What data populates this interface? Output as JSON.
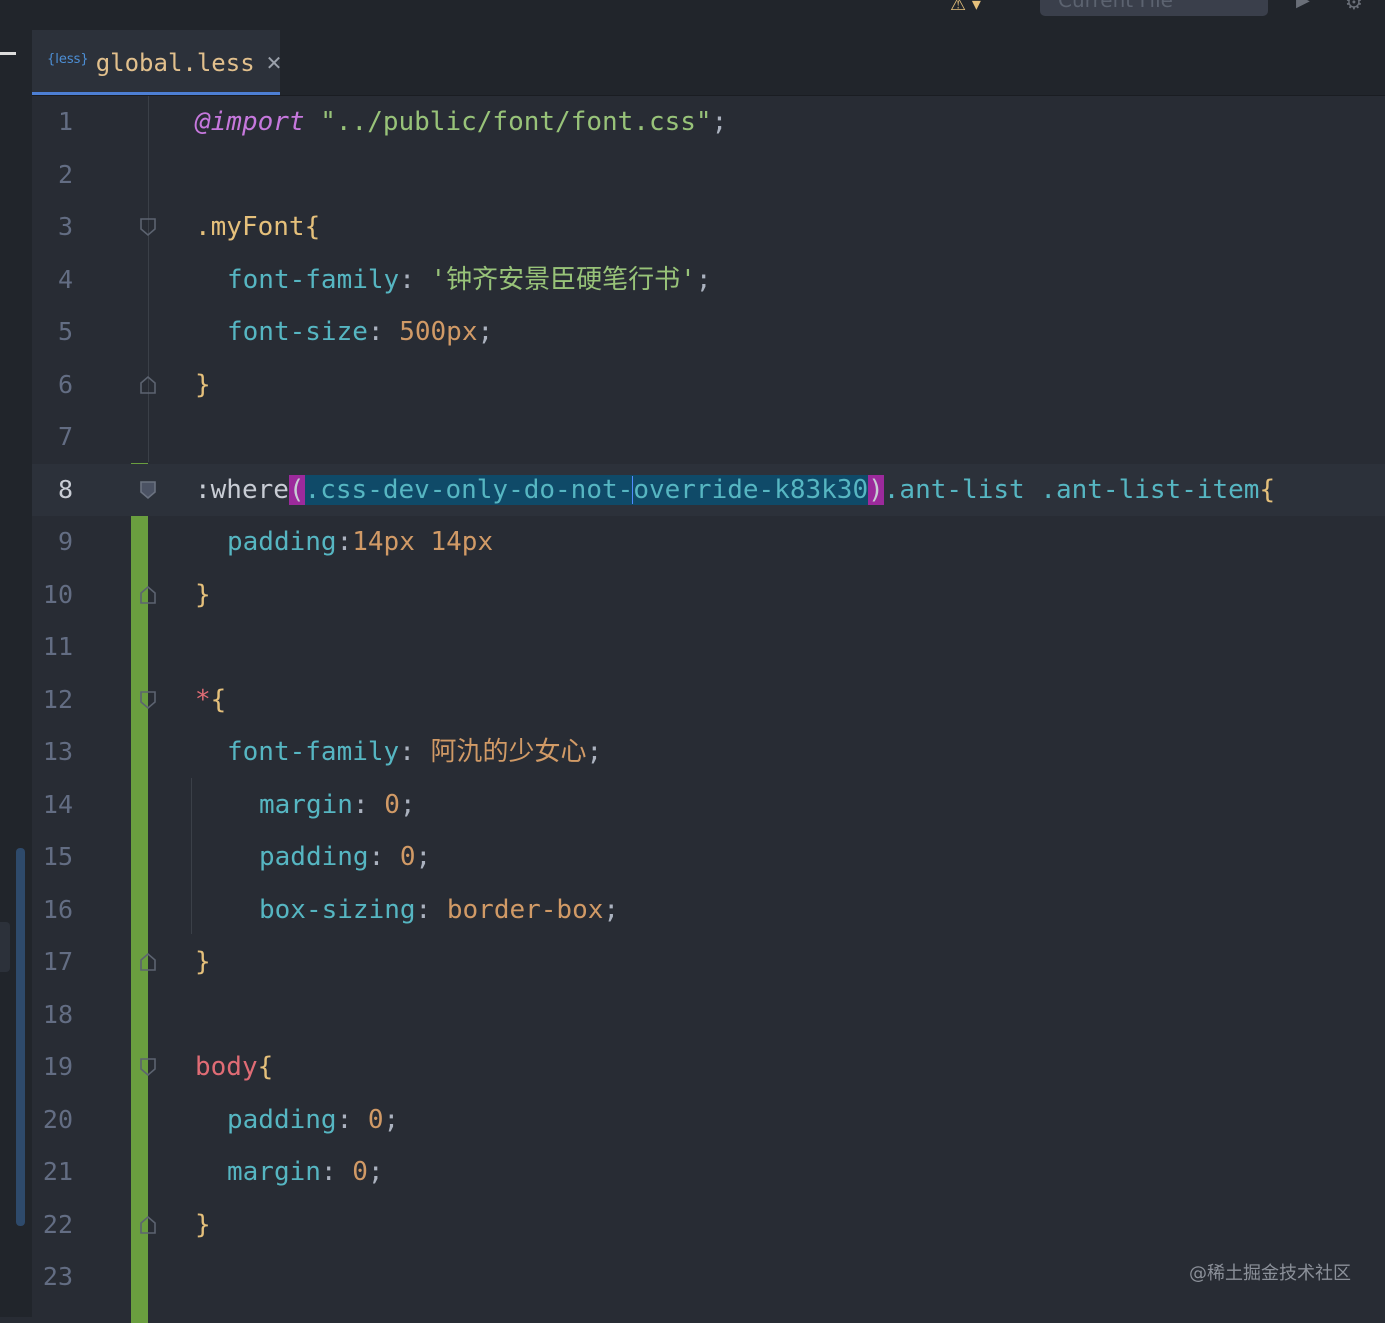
{
  "toolbar": {
    "config_label": "Current File",
    "warn_glyph": "⚠ ▾",
    "run_glyph": "▶",
    "gear_glyph": "⚙"
  },
  "tab": {
    "icon_text": "{less}",
    "label": "global.less",
    "close_glyph": "✕"
  },
  "gutter": {
    "line_numbers": [
      "1",
      "2",
      "3",
      "4",
      "5",
      "6",
      "7",
      "8",
      "9",
      "10",
      "11",
      "12",
      "13",
      "14",
      "15",
      "16",
      "17",
      "18",
      "19",
      "20",
      "21",
      "22",
      "23"
    ],
    "current_line": "8"
  },
  "code": {
    "l1": {
      "kw": "@import",
      "str": "\"../public/font/font.css\"",
      "end": ";"
    },
    "l3": {
      "sel": ".myFont",
      "brace": "{"
    },
    "l4": {
      "prop": "font-family",
      "colon": ": ",
      "val": "'钟齐安景臣硬笔行书'",
      "end": ";"
    },
    "l5": {
      "prop": "font-size",
      "colon": ": ",
      "val": "500px",
      "end": ";"
    },
    "l6": {
      "brace": "}"
    },
    "l8": {
      "pseudo": ":where",
      "paren_open": "(",
      "arg_a": ".css-dev-only-do-not-",
      "arg_b": "override-k83k30",
      "paren_close": ")",
      "rest": ".ant-list .ant-list-item",
      "brace": "{"
    },
    "l9": {
      "prop": "padding",
      "colon": ":",
      "val": "14px 14px"
    },
    "l10": {
      "brace": "}"
    },
    "l12": {
      "sel": "*",
      "brace": "{"
    },
    "l13": {
      "prop": "font-family",
      "colon": ": ",
      "val": "阿氿的少女心",
      "end": ";"
    },
    "l14": {
      "prop": "margin",
      "colon": ": ",
      "val": "0",
      "end": ";"
    },
    "l15": {
      "prop": "padding",
      "colon": ": ",
      "val": "0",
      "end": ";"
    },
    "l16": {
      "prop": "box-sizing",
      "colon": ": ",
      "val": "border-box",
      "end": ";"
    },
    "l17": {
      "brace": "}"
    },
    "l19": {
      "sel": "body",
      "brace": "{"
    },
    "l20": {
      "prop": "padding",
      "colon": ": ",
      "val": "0",
      "end": ";"
    },
    "l21": {
      "prop": "margin",
      "colon": ": ",
      "val": "0",
      "end": ";"
    },
    "l22": {
      "brace": "}"
    }
  },
  "watermark": "@稀土掘金技术社区",
  "colors": {
    "background": "#282c34",
    "tab_underline": "#4d7fd4",
    "change_bar": "#6a9e3f",
    "selection": "#0f4a68",
    "paren_match": "#9c2a9c"
  }
}
